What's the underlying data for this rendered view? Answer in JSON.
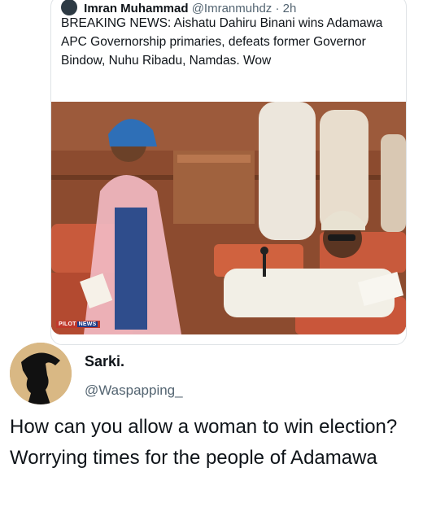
{
  "quoted_tweet": {
    "author_name": "Imran Muhammad",
    "author_handle": "@Imranmuhdz",
    "separator": "·",
    "time": "2h",
    "text": "BREAKING NEWS: Aishatu Dahiru Binani wins Adamawa APC Governorship primaries, defeats former Governor Bindow, Nuhu Ribadu, Namdas. Wow",
    "watermark_a": "PILOT",
    "watermark_b": "NEWS"
  },
  "reply": {
    "author_name": "Sarki.",
    "author_handle": "@Waspapping_",
    "text": "How can you allow a woman to win election? Worrying times for the people of Adamawa"
  },
  "colors": {
    "text": "#0f1419",
    "secondary": "#536471",
    "border": "#dfe3e6"
  }
}
